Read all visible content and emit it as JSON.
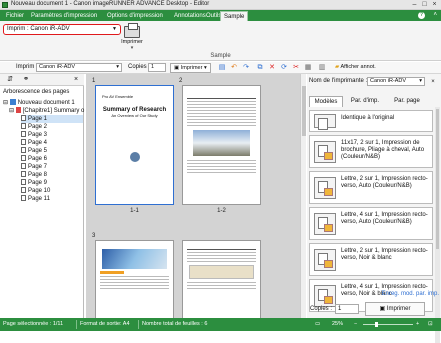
{
  "window": {
    "title": "Nouveau document 1 - Canon imageRUNNER ADVANCE Desktop - Editor"
  },
  "ribbon": {
    "tabs": [
      "Fichier",
      "Paramètres d'impression",
      "Options d'impression",
      "Annotations",
      "Outils",
      "Sample"
    ],
    "active_tab": "Sample",
    "printer_select": "Imprim : Canon iR-ADV",
    "print_button": "Imprimer",
    "group_label": "Sample"
  },
  "toolbar": {
    "printer_label": "Imprim :",
    "printer_value": "Canon iR-ADV",
    "copies_label": "Copies :",
    "copies_value": "1",
    "print_button": "Imprimer",
    "annotations_button": "Afficher annot."
  },
  "left_panel": {
    "tree_title": "Arborescence des pages",
    "document": "Nouveau document 1",
    "chapter": "[Chapitre1] Summary o",
    "pages": [
      "Page 1",
      "Page 2",
      "Page 3",
      "Page 4",
      "Page 5",
      "Page 6",
      "Page 7",
      "Page 8",
      "Page 9",
      "Page 10",
      "Page 11"
    ],
    "selected_page": "Page 1"
  },
  "center": {
    "sheet_numbers": [
      "1",
      "2",
      "3"
    ],
    "captions": [
      "1-1",
      "1-2"
    ],
    "page1_header": "Pro AV Ensemble",
    "page1_title": "Summary of Research",
    "page1_subtitle": "An Overview of Our Study"
  },
  "right_panel": {
    "printer_label": "Nom de l'imprimante :",
    "printer_value": "Canon iR-ADV",
    "tabs": [
      "Modèles",
      "Par. d'imp.",
      "Par. page"
    ],
    "active_tab": "Modèles",
    "settings": [
      "Identique à l'original",
      "11x17, 2 sur 1, Impression de brochure, Pliage à cheval, Auto (Couleur/N&B)",
      "Lettre, 2 sur 1, Impression recto-verso, Auto (Couleur/N&B)",
      "Lettre, 4 sur 1, Impression recto-verso, Auto (Couleur/N&B)",
      "Lettre, 2 sur 1, Impression recto-verso, Noir & blanc",
      "Lettre, 4 sur 1, Impression recto-verso, Noir & blanc"
    ],
    "link": "Enreg. mod. par. imp.",
    "copies_label": "Copies :",
    "copies_value": "1",
    "print_button": "Imprimer"
  },
  "status": {
    "selected": "Page sélectionnée : 1/11",
    "format": "Format de sortie: A4",
    "total": "Nombre total de feuilles : 6",
    "zoom": "25%",
    "zoom_level": 0.25
  }
}
